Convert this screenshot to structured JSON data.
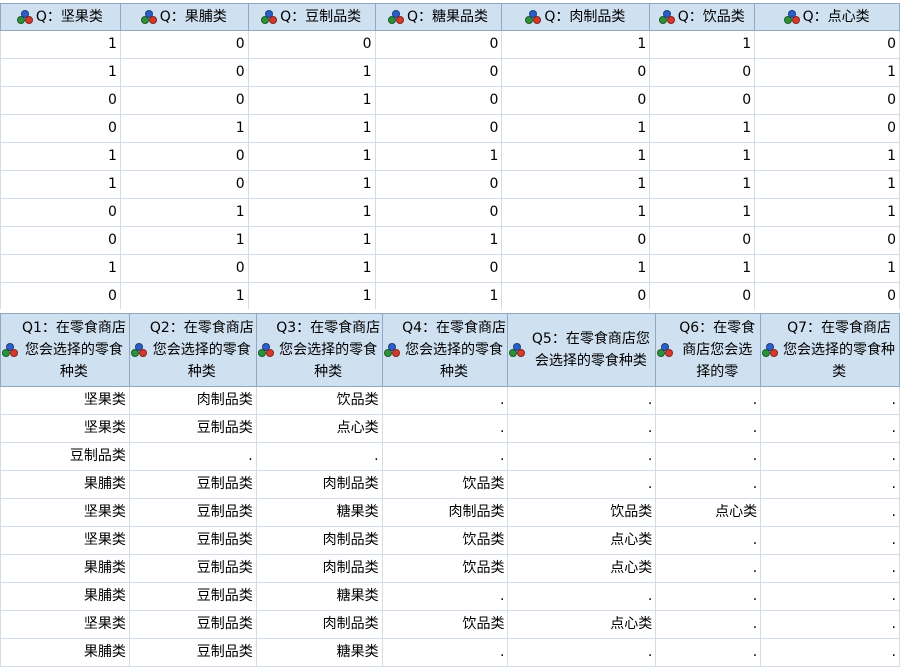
{
  "top_table": {
    "headers": [
      "Q：坚果类",
      "Q：果脯类",
      "Q：豆制品类",
      "Q：糖果品类",
      "Q：肉制品类",
      "Q：饮品类",
      "Q：点心类"
    ],
    "header_icon": "nominal-variable-icon",
    "rows": [
      [
        "1",
        "0",
        "0",
        "0",
        "1",
        "1",
        "0"
      ],
      [
        "1",
        "0",
        "1",
        "0",
        "0",
        "0",
        "1"
      ],
      [
        "0",
        "0",
        "1",
        "0",
        "0",
        "0",
        "0"
      ],
      [
        "0",
        "1",
        "1",
        "0",
        "1",
        "1",
        "0"
      ],
      [
        "1",
        "0",
        "1",
        "1",
        "1",
        "1",
        "1"
      ],
      [
        "1",
        "0",
        "1",
        "0",
        "1",
        "1",
        "1"
      ],
      [
        "0",
        "1",
        "1",
        "0",
        "1",
        "1",
        "1"
      ],
      [
        "0",
        "1",
        "1",
        "1",
        "0",
        "0",
        "0"
      ],
      [
        "1",
        "0",
        "1",
        "0",
        "1",
        "1",
        "1"
      ],
      [
        "0",
        "1",
        "1",
        "1",
        "0",
        "0",
        "0"
      ]
    ]
  },
  "bottom_table": {
    "headers": [
      "Q1：在零食商店您会选择的零食种类",
      "Q2：在零食商店您会选择的零食种类",
      "Q3：在零食商店您会选择的零食种类",
      "Q4：在零食商店您会选择的零食种类",
      "Q5：在零食商店您会选择的零食种类",
      "Q6：在零食商店您会选择的零",
      "Q7：在零食商店您会选择的零食种类"
    ],
    "header_icon": "nominal-variable-icon",
    "rows": [
      [
        "坚果类",
        "肉制品类",
        "饮品类",
        ".",
        ".",
        ".",
        "."
      ],
      [
        "坚果类",
        "豆制品类",
        "点心类",
        ".",
        ".",
        ".",
        "."
      ],
      [
        "豆制品类",
        ".",
        ".",
        ".",
        ".",
        ".",
        "."
      ],
      [
        "果脯类",
        "豆制品类",
        "肉制品类",
        "饮品类",
        ".",
        ".",
        "."
      ],
      [
        "坚果类",
        "豆制品类",
        "糖果类",
        "肉制品类",
        "饮品类",
        "点心类",
        "."
      ],
      [
        "坚果类",
        "豆制品类",
        "肉制品类",
        "饮品类",
        "点心类",
        ".",
        "."
      ],
      [
        "果脯类",
        "豆制品类",
        "肉制品类",
        "饮品类",
        "点心类",
        ".",
        "."
      ],
      [
        "果脯类",
        "豆制品类",
        "糖果类",
        ".",
        ".",
        ".",
        "."
      ],
      [
        "坚果类",
        "豆制品类",
        "肉制品类",
        "饮品类",
        "点心类",
        ".",
        "."
      ],
      [
        "果脯类",
        "豆制品类",
        "糖果类",
        ".",
        ".",
        ".",
        "."
      ]
    ]
  }
}
